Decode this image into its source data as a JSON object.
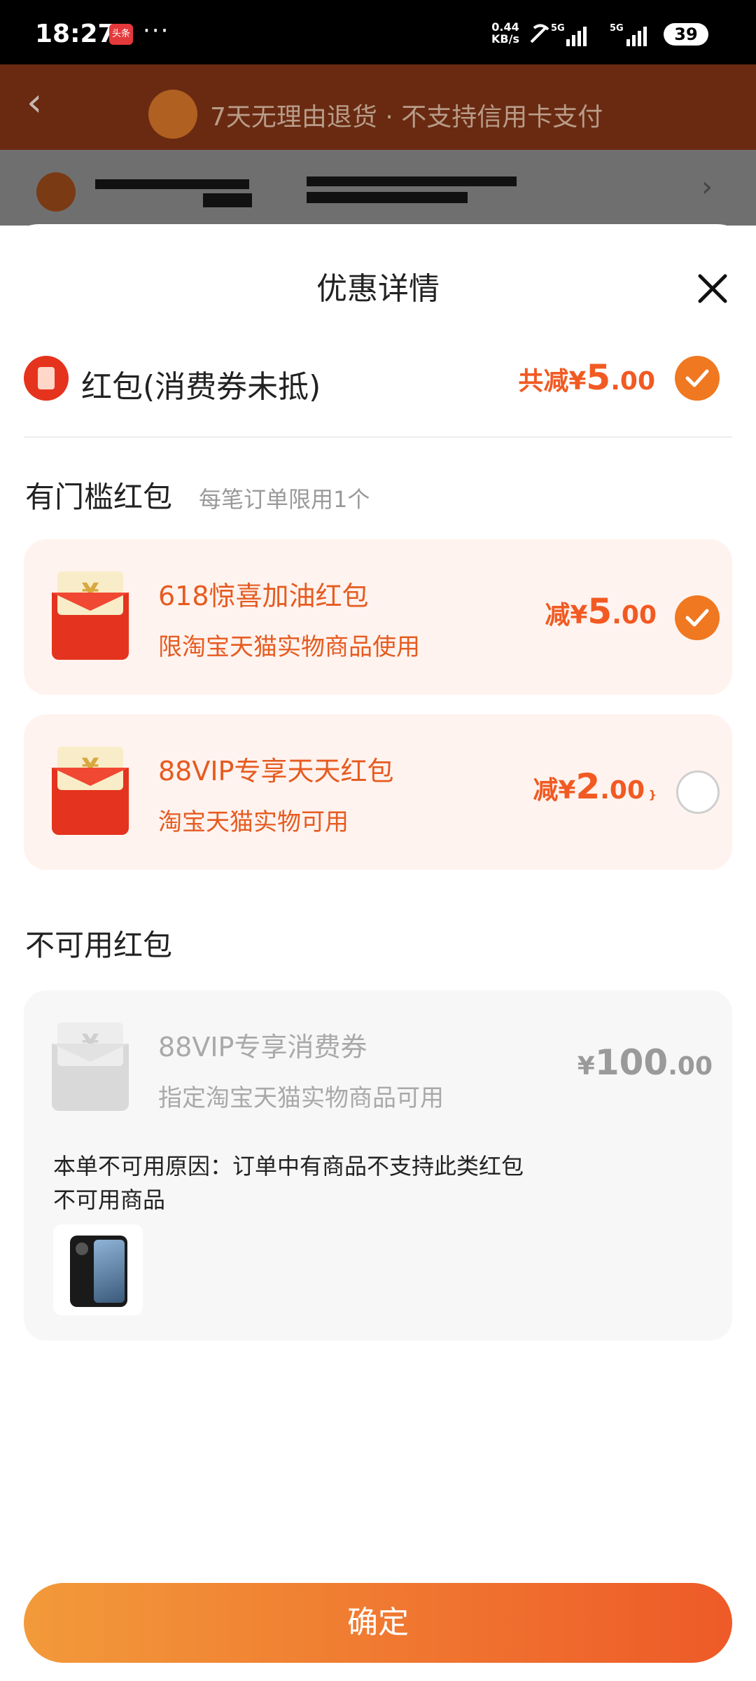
{
  "status_bar": {
    "time": "18:27",
    "app_badge": "头条",
    "more": "···",
    "speed_value": "0.44",
    "speed_unit": "KB/s",
    "network_1": "5G",
    "network_2": "5G",
    "battery": "39"
  },
  "behind_page": {
    "back_icon": "chevron-left-icon",
    "guarantee_text": "7天无理由退货 · 不支持信用卡支付"
  },
  "sheet": {
    "title": "优惠详情",
    "close_icon": "close-icon",
    "red_packet": {
      "label": "红包(消费券未抵)",
      "total_prefix": "共减¥",
      "total_int": "5",
      "total_dec": ".00",
      "selected": true
    },
    "threshold_section": {
      "title": "有门槛红包",
      "note": "每笔订单限用1个",
      "items": [
        {
          "title": "618惊喜加油红包",
          "subtitle": "限淘宝天猫实物商品使用",
          "amount_prefix": "减¥",
          "amount_int": "5",
          "amount_dec": ".00",
          "selected": true
        },
        {
          "title": "88VIP专享天天红包",
          "subtitle": "淘宝天猫实物可用",
          "amount_prefix": "减¥",
          "amount_int": "2",
          "amount_dec": ".00",
          "selected": false
        }
      ]
    },
    "unavailable_section": {
      "title": "不可用红包",
      "items": [
        {
          "title": "88VIP专享消费券",
          "subtitle": "指定淘宝天猫实物商品可用",
          "amount_prefix": "¥",
          "amount_int": "100",
          "amount_dec": ".00",
          "reason": "本单不可用原因：订单中有商品不支持此类红包",
          "unavailable_goods_label": "不可用商品"
        }
      ]
    },
    "confirm_label": "确定"
  },
  "colors": {
    "accent": "#f15a22",
    "card_bg": "#fff3ef",
    "disabled_card_bg": "#f7f7f7"
  }
}
